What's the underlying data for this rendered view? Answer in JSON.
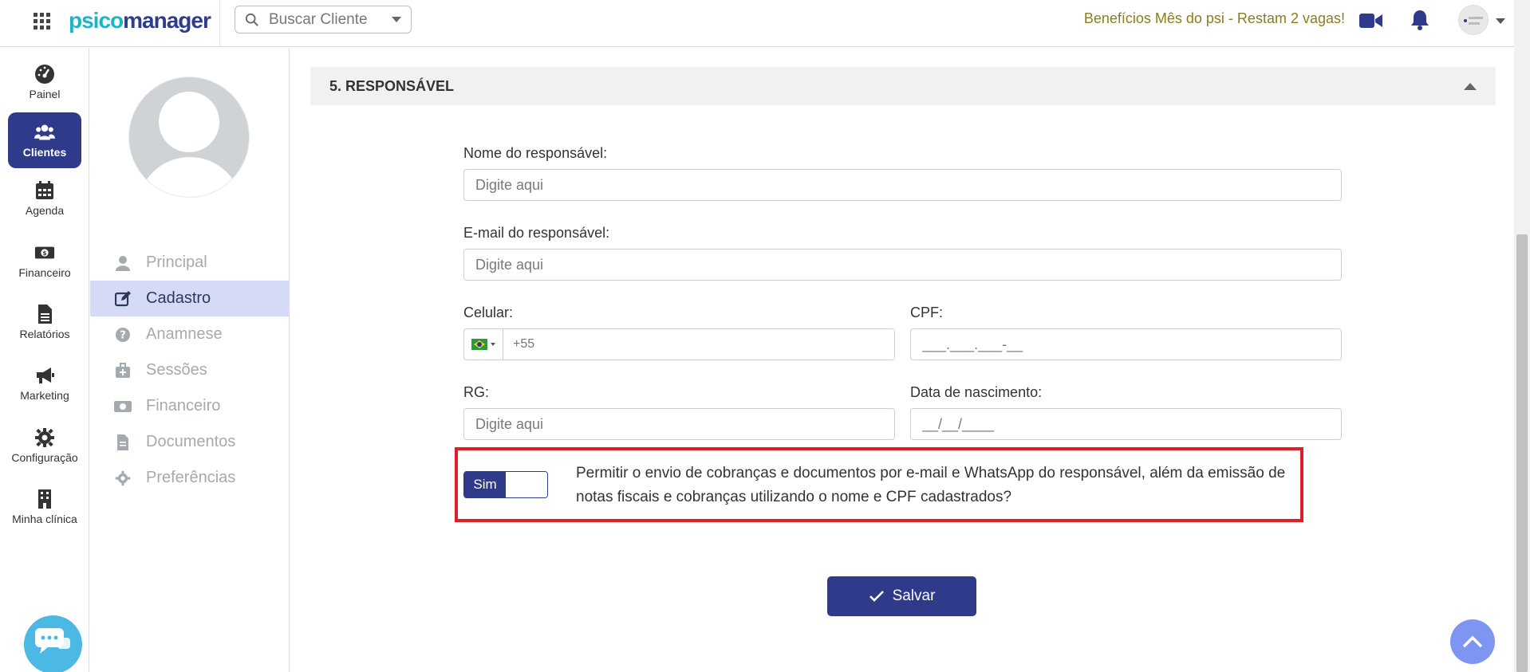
{
  "header": {
    "logo_part1": "psico",
    "logo_part2": "manager",
    "search_label": "Buscar Cliente",
    "promo": "Benefícios Mês do psi - Restam 2 vagas!"
  },
  "leftnav": {
    "items": [
      {
        "label": "Painel",
        "icon": "dashboard-icon"
      },
      {
        "label": "Clientes",
        "icon": "users-icon",
        "active": true
      },
      {
        "label": "Agenda",
        "icon": "calendar-icon"
      },
      {
        "label": "Financeiro",
        "icon": "money-icon"
      },
      {
        "label": "Relatórios",
        "icon": "report-icon"
      },
      {
        "label": "Marketing",
        "icon": "megaphone-icon"
      },
      {
        "label": "Configuração",
        "icon": "gear-icon"
      },
      {
        "label": "Minha clínica",
        "icon": "building-icon"
      }
    ]
  },
  "profile_menu": {
    "items": [
      {
        "label": "Principal",
        "icon": "user-icon"
      },
      {
        "label": "Cadastro",
        "icon": "edit-icon",
        "active": true
      },
      {
        "label": "Anamnese",
        "icon": "question-icon"
      },
      {
        "label": "Sessões",
        "icon": "medical-bag-icon"
      },
      {
        "label": "Financeiro",
        "icon": "money-icon"
      },
      {
        "label": "Documentos",
        "icon": "document-icon"
      },
      {
        "label": "Preferências",
        "icon": "gear-icon"
      }
    ]
  },
  "section": {
    "title": "5. RESPONSÁVEL"
  },
  "form": {
    "nome_label": "Nome do responsável:",
    "nome_placeholder": "Digite aqui",
    "email_label": "E-mail do responsável:",
    "email_placeholder": "Digite aqui",
    "celular_label": "Celular:",
    "celular_placeholder": "+55",
    "cpf_label": "CPF:",
    "cpf_placeholder": "___.___.___-__",
    "rg_label": "RG:",
    "rg_placeholder": "Digite aqui",
    "nascimento_label": "Data de nascimento:",
    "nascimento_placeholder": "__/__/____"
  },
  "consent": {
    "toggle_label": "Sim",
    "text": "Permitir o envio de cobranças e documentos por e-mail e WhatsApp do responsável, além da emissão de notas fiscais e cobranças utilizando o nome e CPF cadastrados?"
  },
  "actions": {
    "save_label": "Salvar"
  },
  "colors": {
    "primary": "#2f3a8a",
    "accent_logo": "#1bb5c7",
    "highlight_border": "#e01e25",
    "promo_text": "#8b7d1a",
    "active_submenu_bg": "#d5daf7"
  }
}
